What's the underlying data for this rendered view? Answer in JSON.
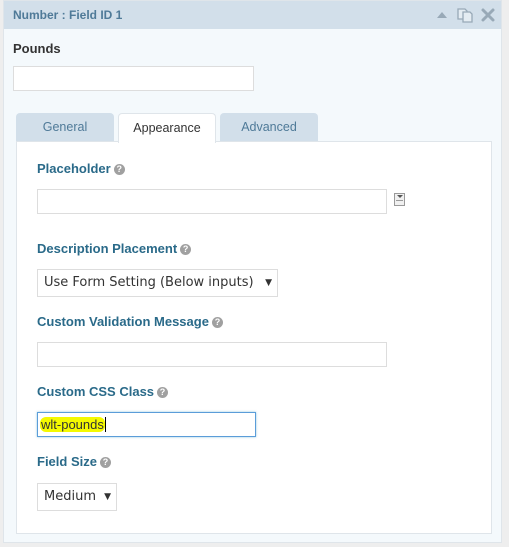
{
  "header": {
    "title": "Number : Field ID 1",
    "icons": [
      "collapse-icon",
      "duplicate-icon",
      "delete-icon"
    ]
  },
  "field": {
    "label": "Pounds",
    "preview_value": ""
  },
  "tabs": [
    {
      "label": "General",
      "active": false
    },
    {
      "label": "Appearance",
      "active": true
    },
    {
      "label": "Advanced",
      "active": false
    }
  ],
  "settings": {
    "placeholder": {
      "label": "Placeholder",
      "value": "",
      "help_icon": "question-circle-icon",
      "merge_tag_icon": "merge-tag-icon"
    },
    "description_placement": {
      "label": "Description Placement",
      "selected": "Use Form Setting (Below inputs)",
      "help_icon": "question-circle-icon"
    },
    "custom_validation": {
      "label": "Custom Validation Message",
      "value": "",
      "help_icon": "question-circle-icon"
    },
    "custom_css": {
      "label": "Custom CSS Class",
      "value": "wlt-pounds",
      "help_icon": "question-circle-icon"
    },
    "field_size": {
      "label": "Field Size",
      "selected": "Medium",
      "help_icon": "question-circle-icon"
    }
  },
  "help_glyph": "?",
  "dropdown_glyph": "▼",
  "colors": {
    "header_bg": "#d2dfea",
    "header_text": "#4f7a98",
    "setting_label": "#2a6a89",
    "highlight": "#f4f900"
  }
}
